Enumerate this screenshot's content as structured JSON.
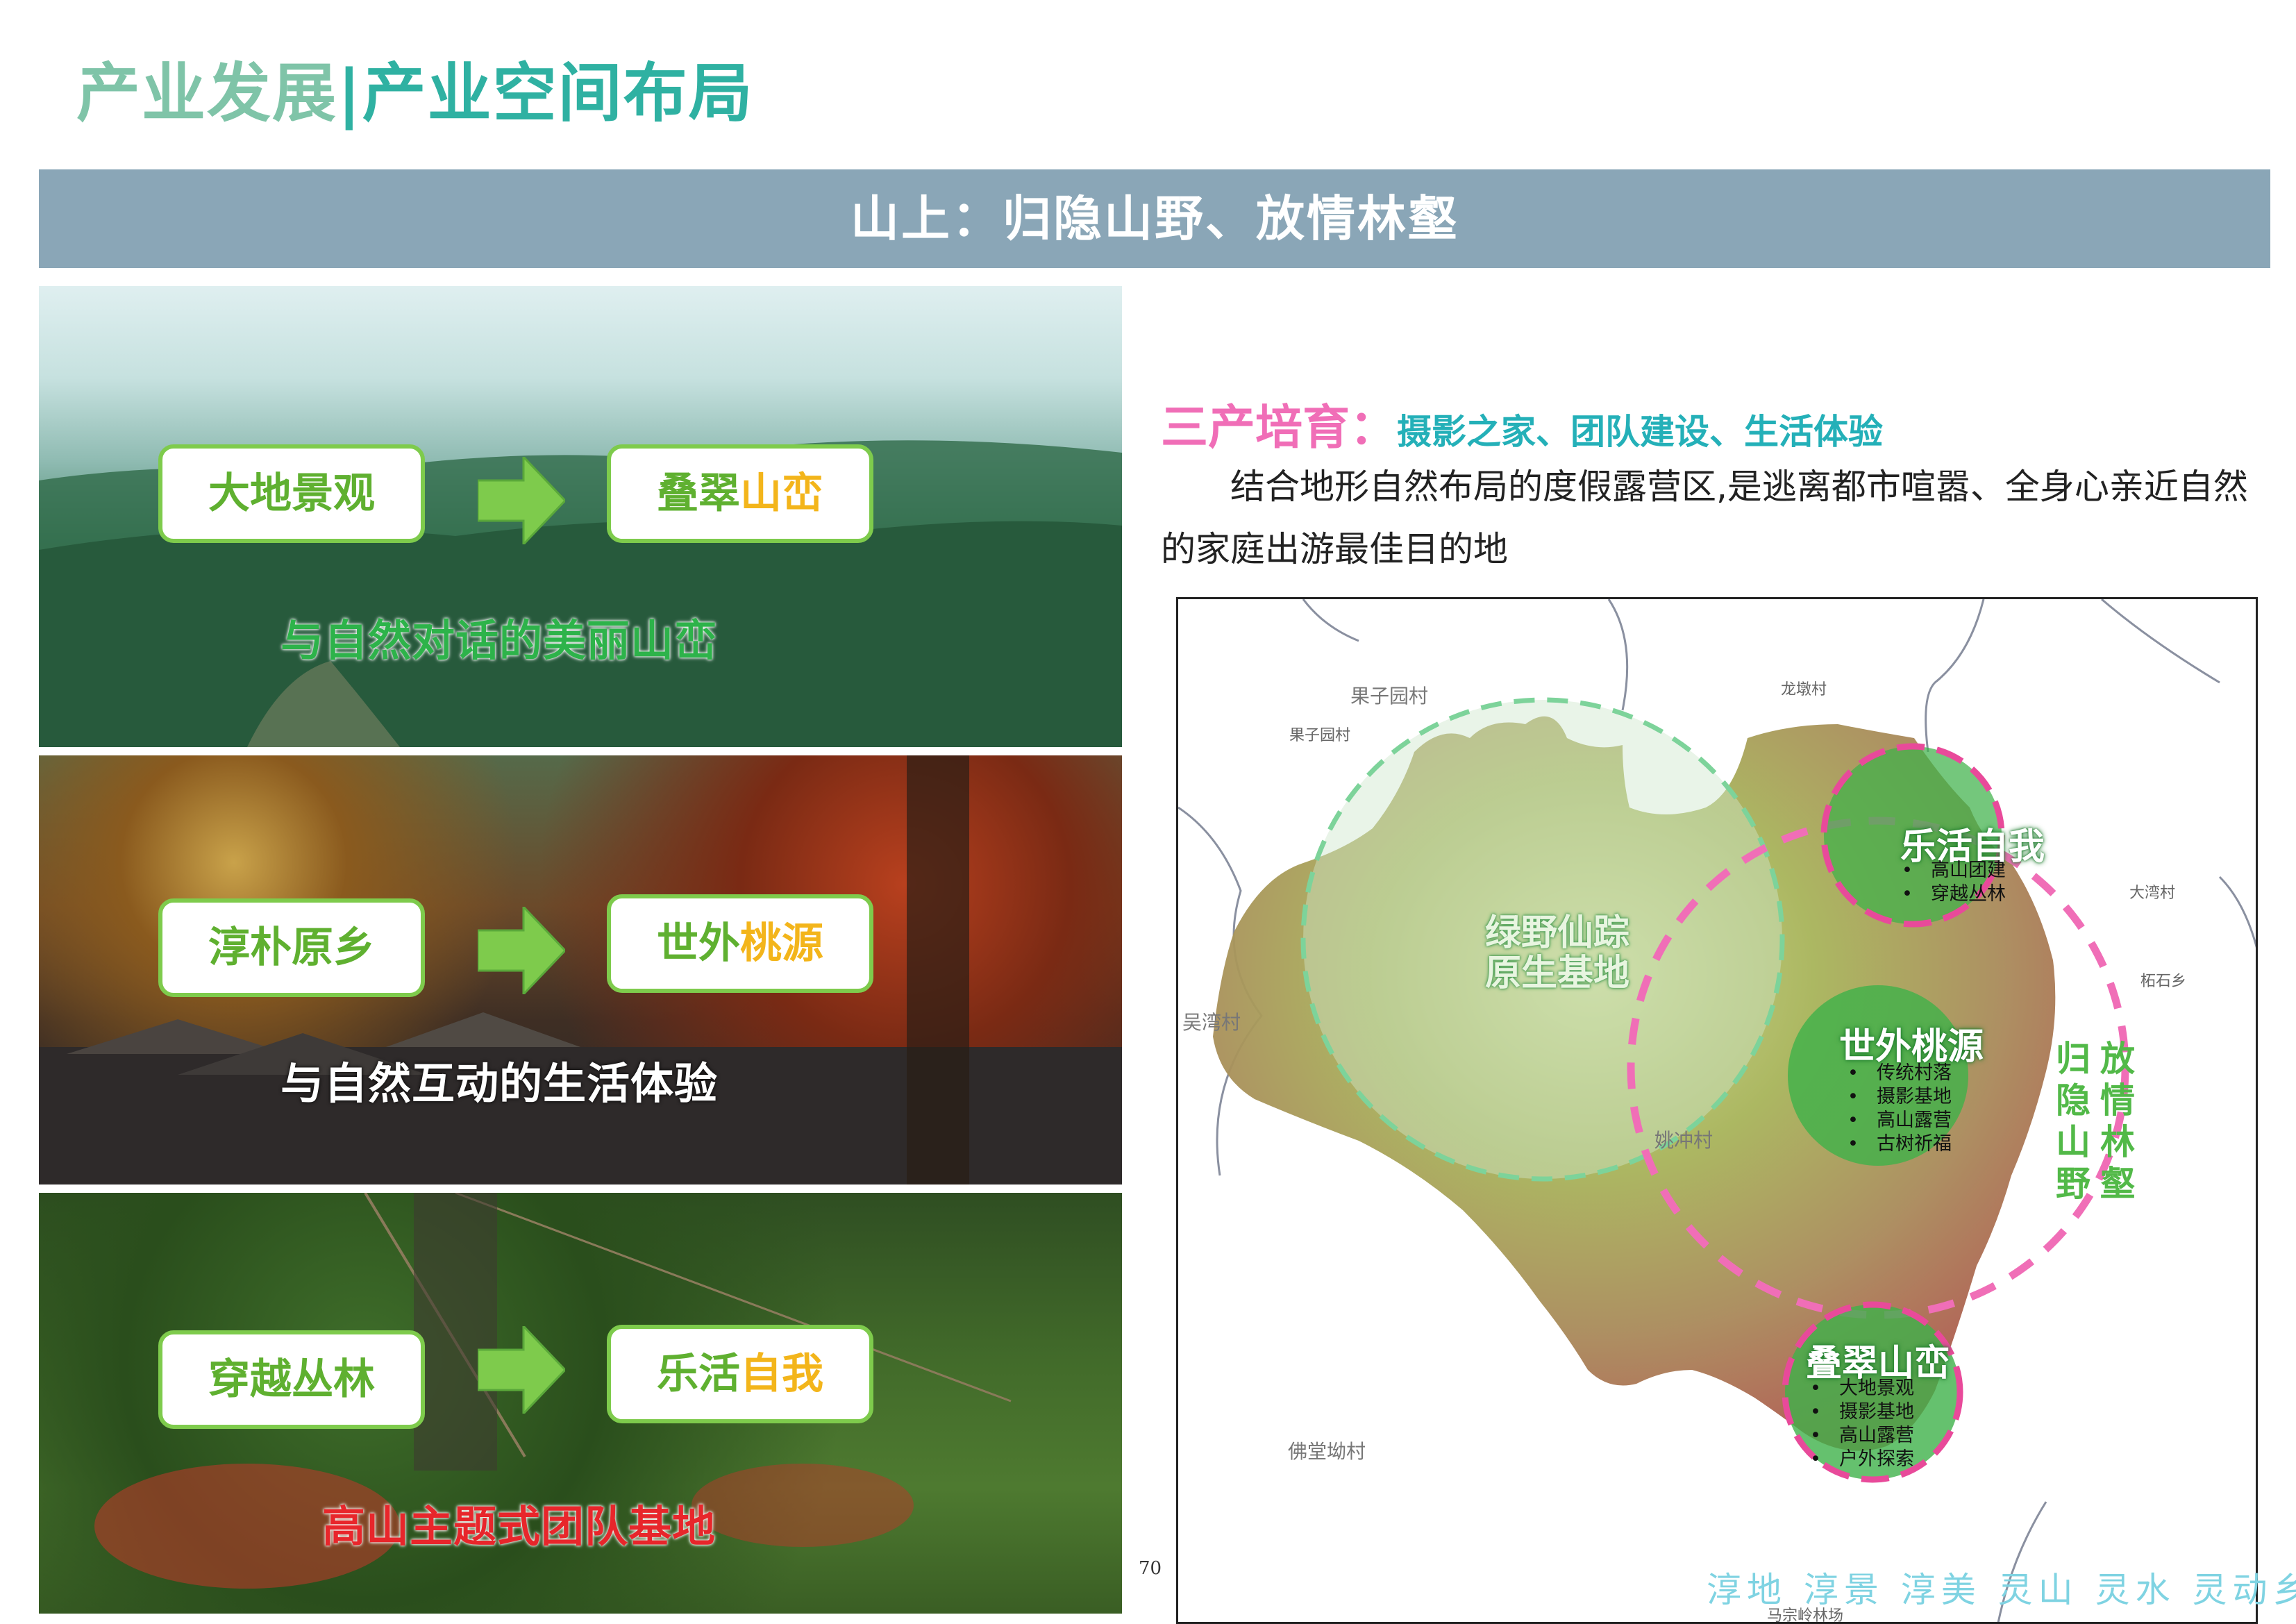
{
  "header": {
    "title_part1": "产业发展",
    "title_sep": "|",
    "title_part2": "产业空间布局",
    "banner": "山上：归隐山野、放情林壑"
  },
  "panels": [
    {
      "from": "大地景观",
      "to_plain": "叠翠",
      "to_highlight": "山峦",
      "caption": "与自然对话的美丽山峦",
      "caption_color": "#2db34a"
    },
    {
      "from": "淳朴原乡",
      "to_plain": "世外",
      "to_highlight": "桃源",
      "caption": "与自然互动的生活体验",
      "caption_color": "#ffffff"
    },
    {
      "from": "穿越丛林",
      "to_plain": "乐活",
      "to_highlight": "自我",
      "caption": "高山主题式团队基地",
      "caption_color": "#e8262b"
    }
  ],
  "right": {
    "subhead_label": "三产培育",
    "subhead_colon": "：",
    "subhead_items": "摄影之家、团队建设、生活体验",
    "paragraph_line1": "结合地形自然布局的度假露营区,是逃离都市喧嚣、全身心亲近自然",
    "paragraph_line2": "的家庭出游最佳目的地"
  },
  "map": {
    "villages": {
      "guoziyuan_large": "果子园村",
      "guoziyuan_small": "果子园村",
      "longdun": "龙墩村",
      "dawan": "大湾村",
      "jiashi": "柘石乡",
      "wuwan": "吴湾村",
      "yaochong": "姚冲村",
      "fotang": "佛堂坳村",
      "mazongling": "马宗岭林场"
    },
    "zones": {
      "lvye_line1": "绿野仙踪",
      "lvye_line2": "原生基地",
      "lehuo": "乐活自我",
      "shiwai": "世外桃源",
      "diecui": "叠翠山峦"
    },
    "lehuo_items": [
      "高山团建",
      "穿越丛林"
    ],
    "shiwai_items": [
      "传统村落",
      "摄影基地",
      "高山露营",
      "古树祈福"
    ],
    "diecui_items": [
      "大地景观",
      "摄影基地",
      "高山露营",
      "户外探索"
    ],
    "vertical_col1": [
      "归",
      "隐",
      "山",
      "野"
    ],
    "vertical_col2": [
      "放",
      "情",
      "林",
      "壑"
    ]
  },
  "footer": {
    "page_number": "70",
    "slogan": "淳地 淳景 淳美 灵山 灵水 灵动乡村"
  },
  "colors": {
    "title_light": "#7fc4a8",
    "title_teal": "#2fb1a2",
    "banner_bg": "#8aa6b7",
    "box_border": "#7ecb4c",
    "box_green": "#5fb030",
    "box_yellow": "#f3b51b",
    "pink_dashed": "#f06eb7",
    "zone_green": "#3fb24a"
  }
}
